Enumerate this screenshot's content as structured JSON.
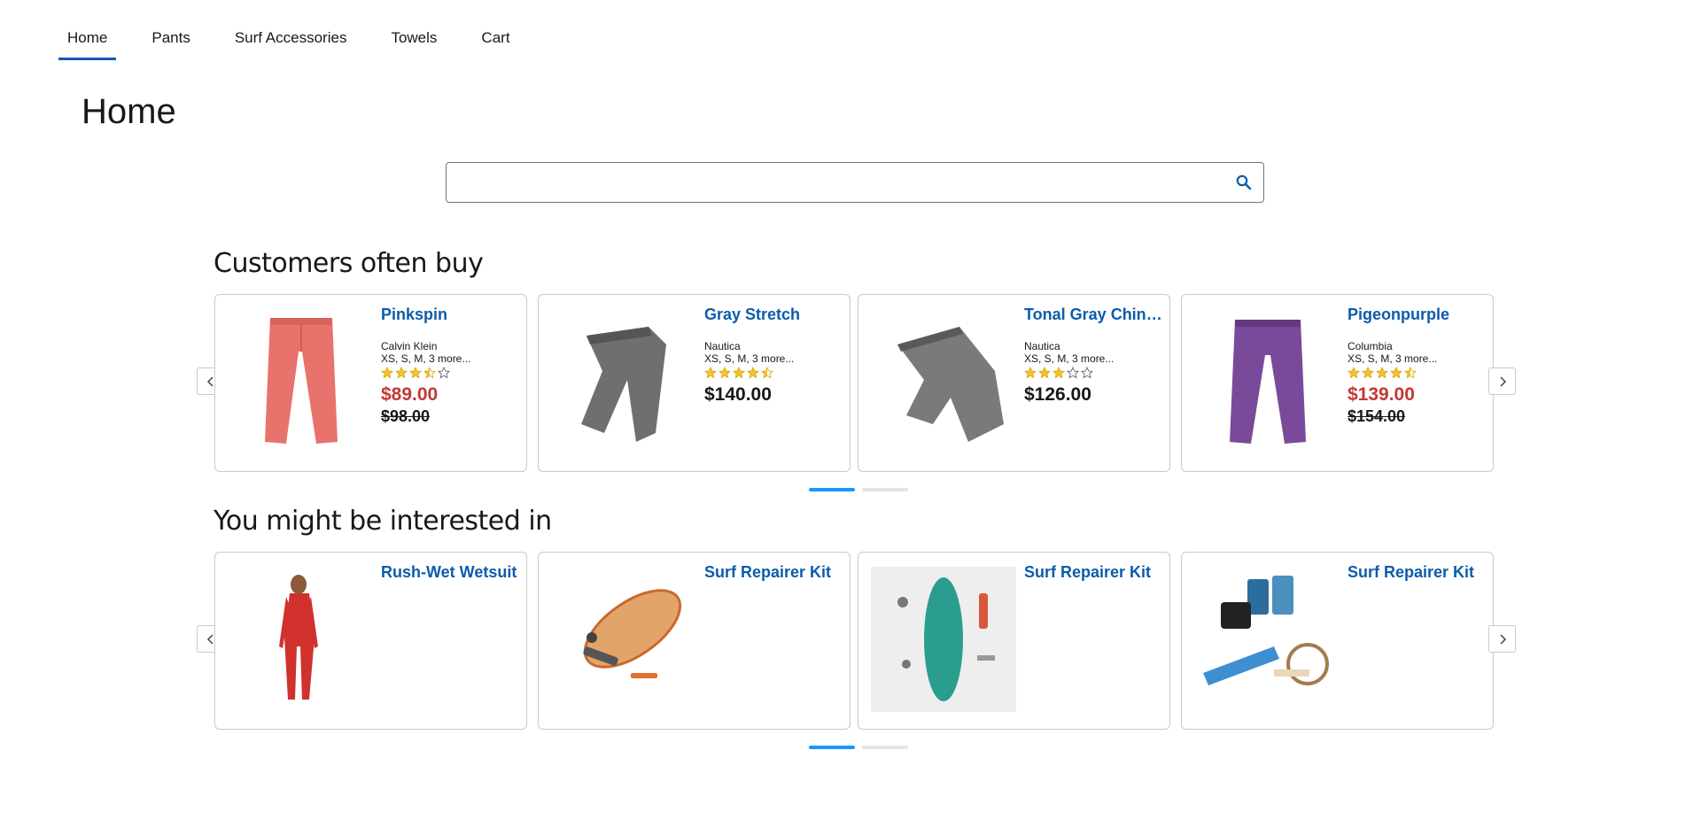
{
  "nav": {
    "items": [
      {
        "label": "Home",
        "active": true
      },
      {
        "label": "Pants",
        "active": false
      },
      {
        "label": "Surf Accessories",
        "active": false
      },
      {
        "label": "Towels",
        "active": false
      },
      {
        "label": "Cart",
        "active": false
      }
    ]
  },
  "page_title": "Home",
  "search": {
    "value": "",
    "placeholder": "",
    "icon": "search-icon"
  },
  "colors": {
    "link": "#0b5cab",
    "sale_price": "#c23934",
    "active_dot": "#1b96ff",
    "star": "#f4c430"
  },
  "sections": [
    {
      "heading": "Customers often buy",
      "products": [
        {
          "title": "Pinkspin",
          "brand": "Calvin Klein",
          "sizes": "XS, S, M, 3 more...",
          "rating": 3.5,
          "price": "$89.00",
          "original_price": "$98.00",
          "image": "pink-pants"
        },
        {
          "title": "Gray Stretch",
          "brand": "Nautica",
          "sizes": "XS, S, M, 3 more...",
          "rating": 4.5,
          "price": "$140.00",
          "original_price": "",
          "image": "gray-pants"
        },
        {
          "title": "Tonal Gray Chinos",
          "brand": "Nautica",
          "sizes": "XS, S, M, 3 more...",
          "rating": 3,
          "price": "$126.00",
          "original_price": "",
          "image": "gray-chinos"
        },
        {
          "title": "Pigeonpurple",
          "brand": "Columbia",
          "sizes": "XS, S, M, 3 more...",
          "rating": 4.5,
          "price": "$139.00",
          "original_price": "$154.00",
          "image": "purple-pants"
        }
      ],
      "pages": 2,
      "active_page": 0
    },
    {
      "heading": "You might be interested in",
      "products": [
        {
          "title": "Rush-Wet Wetsuit",
          "image": "wetsuit"
        },
        {
          "title": "Surf Repairer Kit",
          "image": "surfboard-kit"
        },
        {
          "title": "Surf Repairer Kit",
          "image": "teal-board-kit"
        },
        {
          "title": "Surf Repairer Kit",
          "image": "repair-cans"
        }
      ],
      "pages": 2,
      "active_page": 0
    }
  ]
}
